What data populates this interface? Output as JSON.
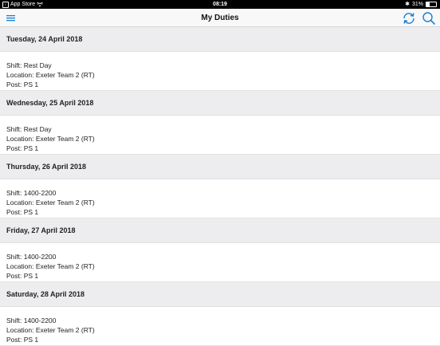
{
  "status_bar": {
    "carrier": "App Store",
    "time": "08:19",
    "battery_percent": "31%",
    "battery_level": 0.31
  },
  "navbar": {
    "title": "My Duties",
    "icons": [
      "menu-icon",
      "refresh-icon",
      "search-icon"
    ],
    "accent_color": "#1a7fd4"
  },
  "days": [
    {
      "date": "Tuesday, 24 April 2018",
      "shift": "Shift: Rest Day",
      "location": "Location: Exeter Team 2 (RT)",
      "post": "Post: PS 1"
    },
    {
      "date": "Wednesday, 25 April 2018",
      "shift": "Shift: Rest Day",
      "location": "Location: Exeter Team 2 (RT)",
      "post": "Post: PS 1"
    },
    {
      "date": "Thursday, 26 April 2018",
      "shift": "Shift: 1400-2200",
      "location": "Location: Exeter Team 2 (RT)",
      "post": "Post: PS 1"
    },
    {
      "date": "Friday, 27 April 2018",
      "shift": "Shift: 1400-2200",
      "location": "Location: Exeter Team 2 (RT)",
      "post": "Post: PS 1"
    },
    {
      "date": "Saturday, 28 April 2018",
      "shift": "Shift: 1400-2200",
      "location": "Location: Exeter Team 2 (RT)",
      "post": "Post: PS 1"
    }
  ]
}
